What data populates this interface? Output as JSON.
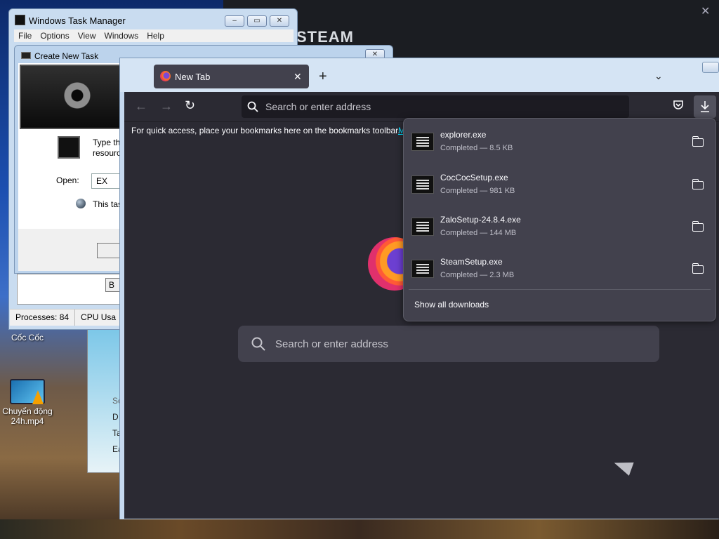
{
  "steam": {
    "logo_text": "STEAM",
    "close_glyph": "✕"
  },
  "desktop": {
    "icons": [
      {
        "label": "Cốc Cốc"
      },
      {
        "label": "Chuyển động 24h.mp4"
      }
    ],
    "partial_window_letters": [
      "Sc",
      "D",
      "Ta",
      "Ea"
    ]
  },
  "task_manager": {
    "title": "Windows Task Manager",
    "menu": [
      "File",
      "Options",
      "View",
      "Windows",
      "Help"
    ],
    "status": {
      "processes": "Processes: 84",
      "cpu": "CPU Usa"
    }
  },
  "create_task": {
    "title": "Create New Task",
    "prompt_line1": "Type th",
    "prompt_line2": "resourc",
    "open_label": "Open:",
    "open_value": "EX",
    "admin_note": "This tas",
    "browse_partial": "B"
  },
  "firefox": {
    "tab": {
      "title": "New Tab",
      "close_glyph": "✕"
    },
    "new_tab_glyph": "+",
    "list_all_tabs_glyph": "⌄",
    "nav": {
      "back": "←",
      "forward": "→",
      "reload": "↻"
    },
    "url_placeholder": "Search or enter address",
    "bookmarks_hint": "For quick access, place your bookmarks here on the bookmarks toolbar.",
    "bookmarks_link_partial": "M",
    "home_search_placeholder": "Search or enter address",
    "downloads": {
      "items": [
        {
          "name": "explorer.exe",
          "status": "Completed — 8.5 KB"
        },
        {
          "name": "CocCocSetup.exe",
          "status": "Completed — 981 KB"
        },
        {
          "name": "ZaloSetup-24.8.4.exe",
          "status": "Completed — 144 MB"
        },
        {
          "name": "SteamSetup.exe",
          "status": "Completed — 2.3 MB"
        }
      ],
      "show_all": "Show all downloads"
    }
  },
  "colors": {
    "firefox_dark": "#2b2a33",
    "panel": "#42414d",
    "accent_link": "#00ddff"
  }
}
